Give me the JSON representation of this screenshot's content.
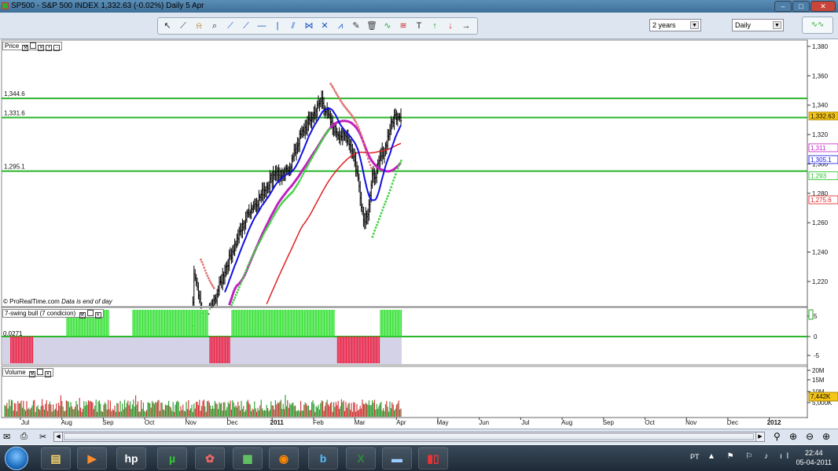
{
  "window": {
    "title": "SP500 - S&P 500 INDEX    1,332.63 (-0.02%)    Daily  5 Apr",
    "min_label": "–",
    "max_label": "□",
    "close_label": "✕"
  },
  "toolbar": {
    "period_select": "2 years",
    "interval_select": "Daily",
    "tools": [
      "pointer-tool",
      "ruler-tool",
      "alert-tool",
      "zoom-tool",
      "trendline-tool",
      "ray-tool",
      "horizontal-line-tool",
      "vertical-line-tool",
      "channel-tool",
      "fibonacci-tool",
      "cross-tool",
      "pattern-tool",
      "pen-tool",
      "delete-tool",
      "indicator-tool",
      "cycle-tool",
      "text-tool",
      "arrow-up-tool",
      "arrow-down-tool",
      "arrow-right-tool"
    ]
  },
  "price_panel": {
    "label": "Price",
    "footer": "© ProRealTime.com",
    "footer_note": "Data is end of day",
    "hlines": [
      {
        "label": "1,344.6",
        "value": 1344.6
      },
      {
        "label": "1,331.6",
        "value": 1331.6
      },
      {
        "label": "1,295.1",
        "value": 1295.1
      }
    ],
    "y_ticks": [
      "1,380",
      "1,360",
      "1,340",
      "1,320",
      "1,300",
      "1,280",
      "1,260",
      "1,240",
      "1,220"
    ],
    "y_values": [
      1380,
      1360,
      1340,
      1320,
      1300,
      1280,
      1260,
      1240,
      1220
    ],
    "badges": [
      {
        "text": "1,332.63",
        "value": 1332.63,
        "color": "#f5c518",
        "text_color": "#000"
      },
      {
        "text": "1,311",
        "value": 1311,
        "color": "#ffffff",
        "text_color": "#c020c0"
      },
      {
        "text": "1,305.1",
        "value": 1305.1,
        "color": "#ffffff",
        "text_color": "#1010e0"
      },
      {
        "text": "1,293",
        "value": 1293,
        "color": "#ffffff",
        "text_color": "#20c020"
      },
      {
        "text": "1,275.6",
        "value": 1275.6,
        "color": "#ffffff",
        "text_color": "#e02020"
      }
    ]
  },
  "swing_panel": {
    "label": "7-swing bull (7 condicion)",
    "level_label": "0.0271",
    "y_ticks": [
      "5",
      "0",
      "-5"
    ]
  },
  "volume_panel": {
    "label": "Volume",
    "y_ticks": [
      "20M",
      "15M",
      "10M",
      "5,000K"
    ],
    "badge": "7,442K"
  },
  "x_axis": {
    "labels": [
      "Jul",
      "Aug",
      "Sep",
      "Oct",
      "Nov",
      "Dec",
      "2011",
      "Feb",
      "Mar",
      "Apr",
      "May",
      "Jun",
      "Jul",
      "Aug",
      "Sep",
      "Oct",
      "Nov",
      "Dec",
      "2012"
    ]
  },
  "taskbar": {
    "lang": "PT",
    "time": "22:44",
    "date": "05-04-2011",
    "apps": [
      "start-orb",
      "explorer",
      "media-player",
      "hp",
      "utorrent",
      "paint",
      "mixer",
      "firefox",
      "b-app",
      "excel",
      "prorealtime",
      "chart-app"
    ]
  },
  "colors": {
    "hline": "#2ab52a",
    "ma_blue": "#1010e0",
    "ma_magenta": "#c020c0",
    "ma_red": "#e02020",
    "sar_green": "#40d040",
    "sar_red": "#e07070",
    "bull": "#33e033",
    "bear": "#ee2244"
  }
}
